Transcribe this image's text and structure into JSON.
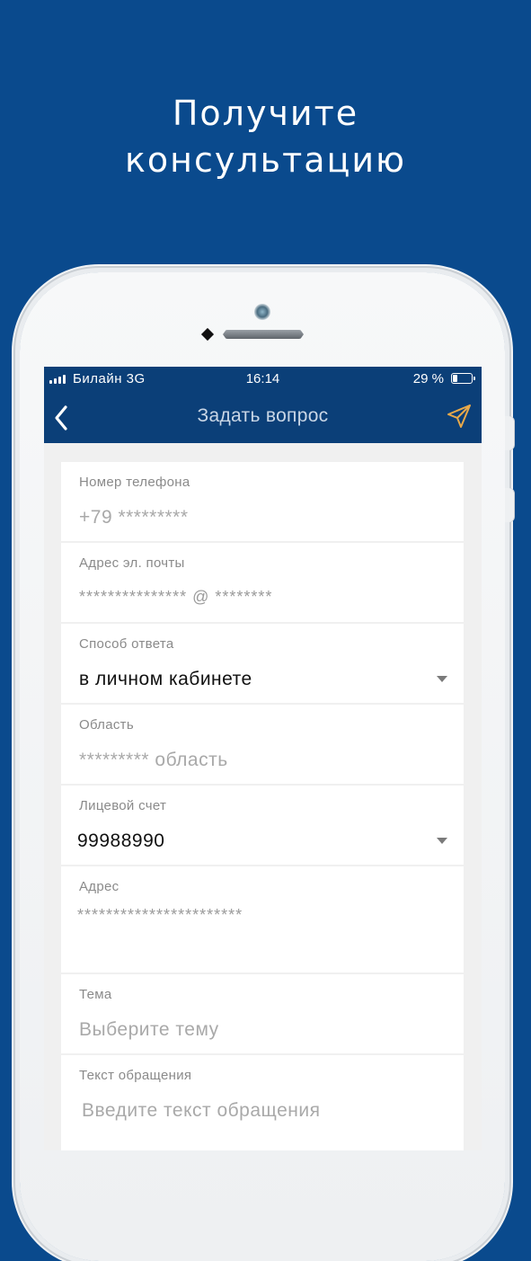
{
  "promo": {
    "title_line1": "Получите",
    "title_line2": "консультацию"
  },
  "status_bar": {
    "carrier": "Билайн  3G",
    "time": "16:14",
    "battery": "29 %",
    "battery_level": 0.29
  },
  "nav": {
    "title": "Задать вопрос",
    "back_icon": "chevron-left-icon",
    "send_icon": "send-icon"
  },
  "form": {
    "phone": {
      "label": "Номер телефона",
      "value": "+79 *********"
    },
    "email": {
      "label": "Адрес эл. почты",
      "value": "*************** @ ********"
    },
    "answer_method": {
      "label": "Способ ответа",
      "value": "в личном кабинете"
    },
    "region": {
      "label": "Область",
      "value": "********* область"
    },
    "account": {
      "label": "Лицевой счет",
      "value": "99988990"
    },
    "address": {
      "label": "Адрес",
      "value": "***********************"
    },
    "topic": {
      "label": "Тема",
      "placeholder": "Выберите тему"
    },
    "message": {
      "label": "Текст обращения",
      "placeholder": "Введите текст обращения"
    }
  },
  "colors": {
    "background": "#0a4a8d",
    "nav_bar": "#0b3f78",
    "send_icon": "#e8a94a"
  }
}
